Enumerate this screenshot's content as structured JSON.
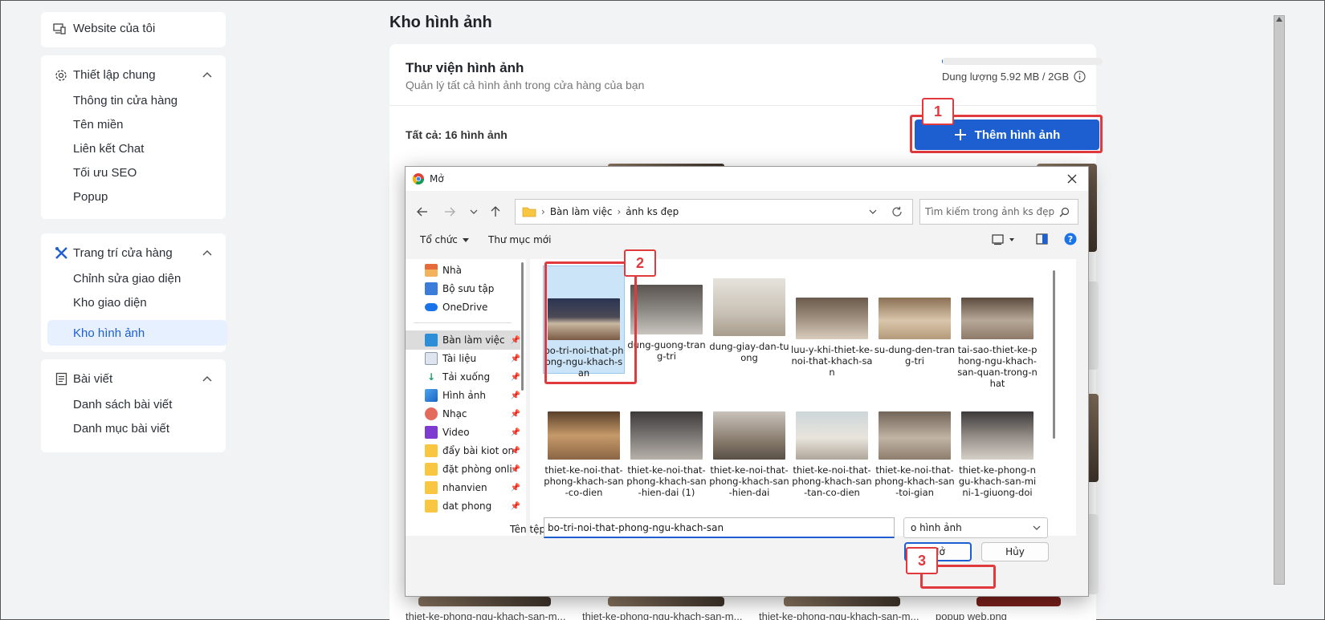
{
  "sidebar": {
    "my_website": "Website của tôi",
    "general": {
      "title": "Thiết lập chung",
      "items": [
        "Thông tin cửa hàng",
        "Tên miền",
        "Liên kết Chat",
        "Tối ưu SEO",
        "Popup"
      ]
    },
    "decor": {
      "title": "Trang trí cửa hàng",
      "items": [
        "Chỉnh sửa giao diện",
        "Kho giao diện",
        "Kho hình ảnh"
      ]
    },
    "posts": {
      "title": "Bài viết",
      "items": [
        "Danh sách bài viết",
        "Danh mục bài viết"
      ]
    }
  },
  "main": {
    "page_title": "Kho hình ảnh",
    "library_title": "Thư viện hình ảnh",
    "library_subtitle": "Quản lý tất cả hình ảnh trong cửa hàng của bạn",
    "storage_label": "Dung lượng 5.92 MB / 2GB",
    "storage_fraction": 0.003,
    "total_label": "Tất cả: 16 hình ảnh",
    "add_button": "Thêm hình ảnh",
    "bottom_captions": [
      "thiet-ke-phong-ngu-khach-san-m...",
      "thiet-ke-phong-ngu-khach-san-m...",
      "thiet-ke-phong-ngu-khach-san-m...",
      "popup web.png"
    ]
  },
  "callouts": [
    "1",
    "2",
    "3"
  ],
  "dialog": {
    "title": "Mở",
    "breadcrumb": [
      "Bàn làm việc",
      "ảnh ks đẹp"
    ],
    "search_placeholder": "Tìm kiếm trong ảnh ks đẹp",
    "organize": "Tổ chức",
    "new_folder": "Thư mục mới",
    "nav": [
      "Nhà",
      "Bộ sưu tập",
      "OneDrive",
      "Bàn làm việc",
      "Tài liệu",
      "Tải xuống",
      "Hình ảnh",
      "Nhạc",
      "Video",
      "đẩy bài kiot onli",
      "đặt phòng onlin",
      "nhanvien",
      "dat phong"
    ],
    "files": [
      "bo-tri-noi-that-phong-ngu-khach-san",
      "dung-guong-trang-tri",
      "dung-giay-dan-tuong",
      "luu-y-khi-thiet-ke-noi-that-khach-san",
      "su-dung-den-trang-tri",
      "tai-sao-thiet-ke-phong-ngu-khach-san-quan-trong-nhat",
      "thiet-ke-noi-that-phong-khach-san-co-dien",
      "thiet-ke-noi-that-phong-khach-san-hien-dai (1)",
      "thiet-ke-noi-that-phong-khach-san-hien-dai",
      "thiet-ke-noi-that-phong-khach-san-tan-co-dien",
      "thiet-ke-noi-that-phong-khach-san-toi-gian",
      "thiet-ke-phong-ngu-khach-san-mini-1-giuong-doi"
    ],
    "filename_label": "Tên tệp:",
    "filename_value": "bo-tri-noi-that-phong-ngu-khach-san",
    "filetype_value": "o hình ảnh",
    "open_button": "Mở",
    "cancel_button": "Hủy",
    "colors": {
      "selected": "#cce4f7",
      "accent": "#1d5fd0",
      "callout": "#e0393e"
    }
  }
}
